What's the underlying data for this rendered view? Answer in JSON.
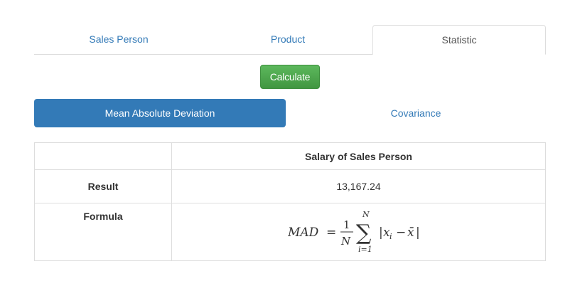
{
  "tabs": [
    {
      "label": "Sales Person",
      "active": false
    },
    {
      "label": "Product",
      "active": false
    },
    {
      "label": "Statistic",
      "active": true
    }
  ],
  "calculate_button": {
    "label": "Calculate"
  },
  "pills": [
    {
      "label": "Mean Absolute Deviation",
      "active": true
    },
    {
      "label": "Covariance",
      "active": false
    }
  ],
  "table": {
    "header": [
      "",
      "Salary of Sales Person"
    ],
    "rows": [
      {
        "label": "Result",
        "value": "13,167.24"
      },
      {
        "label": "Formula",
        "value": "MAD = (1/N) Σ_{i=1}^{N} |x_i − x̄|"
      }
    ]
  },
  "formula": {
    "lhs": "MAD",
    "eq": "=",
    "num": "1",
    "den": "N",
    "sum": "∑",
    "upper": "N",
    "lower": "i=1",
    "abs_open": "|",
    "x": "x",
    "sub": "i",
    "minus": "−",
    "xbar": "x̄",
    "abs_close": "|"
  },
  "colors": {
    "link": "#337ab7",
    "primary": "#337ab7",
    "success": "#5cb85c",
    "border": "#dddddd"
  }
}
